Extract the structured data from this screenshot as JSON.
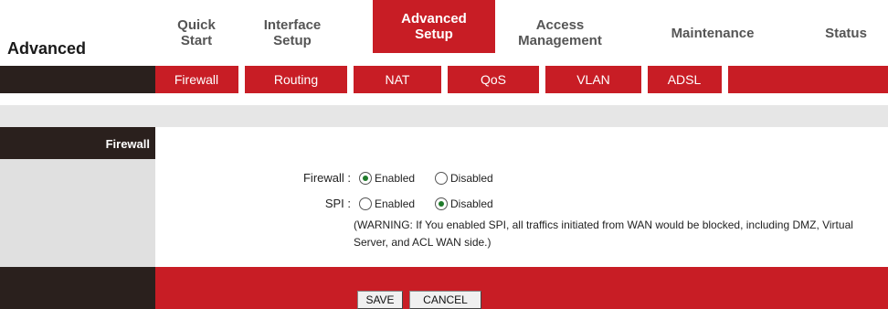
{
  "brand": {
    "title": "Advanced"
  },
  "nav": {
    "items": [
      {
        "label": "Quick\nStart"
      },
      {
        "label": "Interface\nSetup"
      },
      {
        "label": "Advanced\nSetup"
      },
      {
        "label": "Access\nManagement"
      },
      {
        "label": "Maintenance"
      },
      {
        "label": "Status"
      }
    ],
    "active": "Advanced Setup"
  },
  "subnav": {
    "items": [
      {
        "label": "Firewall"
      },
      {
        "label": "Routing"
      },
      {
        "label": "NAT"
      },
      {
        "label": "QoS"
      },
      {
        "label": "VLAN"
      },
      {
        "label": "ADSL"
      }
    ]
  },
  "section": {
    "title": "Firewall"
  },
  "form": {
    "firewall": {
      "label": "Firewall :",
      "enabled_label": "Enabled",
      "disabled_label": "Disabled",
      "selected": "Enabled"
    },
    "spi": {
      "label": "SPI :",
      "enabled_label": "Enabled",
      "disabled_label": "Disabled",
      "selected": "Disabled"
    },
    "warning": "(WARNING: If You enabled SPI, all traffics initiated from WAN would be blocked, including DMZ, Virtual Server, and ACL WAN side.)"
  },
  "buttons": {
    "save": "SAVE",
    "cancel": "CANCEL"
  },
  "colors": {
    "accent": "#c81d25",
    "dark": "#2a201d",
    "band": "#e6e6e6"
  }
}
